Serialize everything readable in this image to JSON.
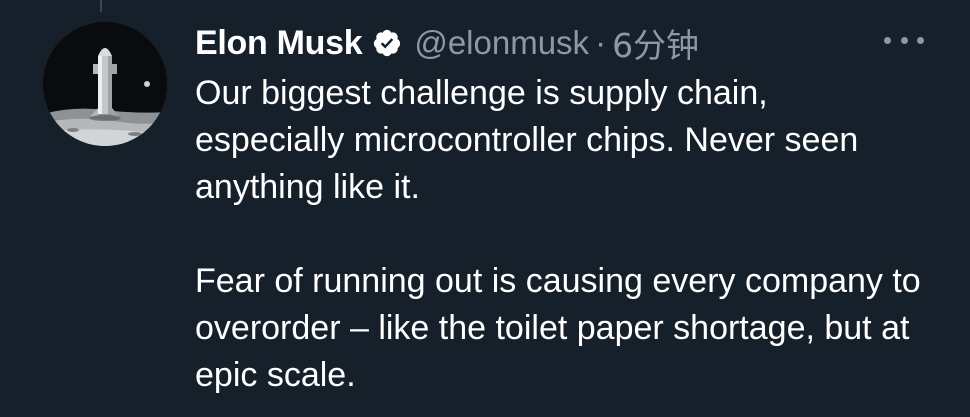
{
  "tweet": {
    "author_name": "Elon Musk",
    "verified": true,
    "handle": "@elonmusk",
    "separator": "·",
    "timestamp": "6分钟",
    "paragraphs": [
      "Our biggest challenge is supply chain, especially microcontroller chips. Never seen anything like it.",
      "Fear of running out is causing every company to overorder – like the toilet paper shortage, but at epic scale."
    ]
  },
  "icons": {
    "verified": "verified-badge-icon",
    "more": "more-options-icon"
  },
  "colors": {
    "background": "#16202b",
    "primary_text": "#ffffff",
    "secondary_text": "#8b98a5"
  }
}
